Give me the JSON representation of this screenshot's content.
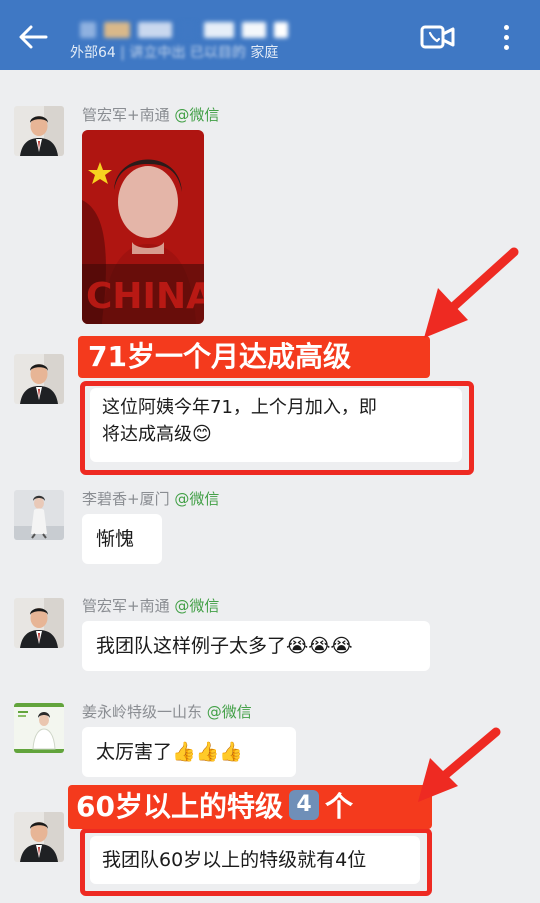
{
  "header": {
    "title": "",
    "subtitle_prefix": "外部64",
    "subtitle_suffix": "家庭",
    "colors": {
      "bar": "#3f78c4"
    }
  },
  "messages": [
    {
      "sender_name": "管宏军+南通",
      "sender_tag": "@微信",
      "kind": "image",
      "image_text": "CHINA"
    },
    {
      "sender_name": "",
      "kind": "text",
      "text_line1": "这位阿姨今年71，上个月加入，即",
      "text_line2": "将达成高级",
      "emoji": "😊"
    },
    {
      "sender_name": "李碧香+厦门",
      "sender_tag": "@微信",
      "kind": "text",
      "text": "惭愧"
    },
    {
      "sender_name": "管宏军+南通",
      "sender_tag": "@微信",
      "kind": "text",
      "text": "我团队这样例子太多了",
      "emojis": "😭😭😭"
    },
    {
      "sender_name": "姜永岭特级一山东",
      "sender_tag": "@微信",
      "kind": "text",
      "text": "太厉害了",
      "emojis": "👍👍👍"
    },
    {
      "sender_name": "",
      "kind": "text",
      "text": "我团队60岁以上的特级就有4位"
    }
  ],
  "annotations": {
    "label1": "71岁一个月达成高级",
    "label2_prefix": "60岁以上的特级",
    "label2_keycap": "4",
    "label2_suffix": "个",
    "color": "#f43a1d"
  },
  "icons": [
    "back-arrow-icon",
    "video-call-icon",
    "more-vertical-icon"
  ]
}
